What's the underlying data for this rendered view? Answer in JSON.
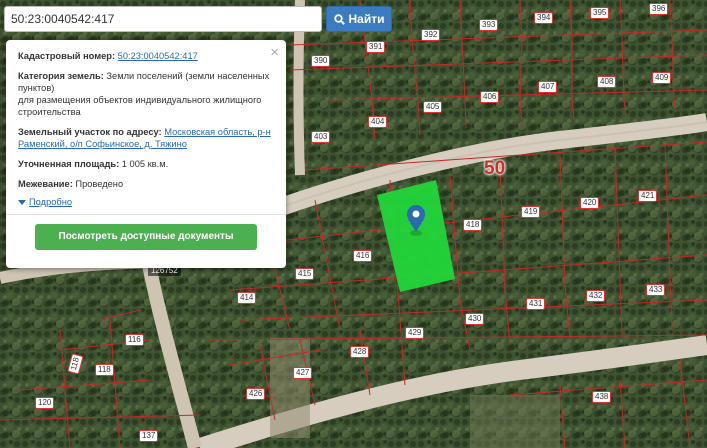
{
  "search": {
    "value": "50:23:0040542:417",
    "button_label": "Найти",
    "button_icon": "search-icon"
  },
  "popup": {
    "close_glyph": "×",
    "cadastral_label": "Кадастровый номер:",
    "cadastral_value": "50:23:0040542:417",
    "category_label": "Категория земель:",
    "category_value": "Земли поселений (земли населенных пунктов)",
    "usage_value": "для размещения объектов индивидуального жилищного строительства",
    "address_label": "Земельный участок по адресу:",
    "address_value": "Московская область, р-н Раменский, о/п Софьинское, д. Тяжино",
    "area_label": "Уточненная площадь:",
    "area_value": "1 005 кв.м.",
    "survey_label": "Межевание:",
    "survey_value": "Проведено",
    "details_label": "Подробно",
    "docs_button": "Посмотреть доступные документы"
  },
  "map": {
    "quarter_label": "50",
    "road_tag": "126752",
    "plots": [
      {
        "label": "393"
      },
      {
        "label": "394"
      },
      {
        "label": "395"
      },
      {
        "label": "396"
      },
      {
        "label": "391"
      },
      {
        "label": "392"
      },
      {
        "label": "390"
      },
      {
        "label": "407"
      },
      {
        "label": "408"
      },
      {
        "label": "409"
      },
      {
        "label": "406"
      },
      {
        "label": "405"
      },
      {
        "label": "404"
      },
      {
        "label": "403"
      },
      {
        "label": "419"
      },
      {
        "label": "420"
      },
      {
        "label": "421"
      },
      {
        "label": "418"
      },
      {
        "label": "416"
      },
      {
        "label": "415"
      },
      {
        "label": "414"
      },
      {
        "label": "431"
      },
      {
        "label": "432"
      },
      {
        "label": "433"
      },
      {
        "label": "430"
      },
      {
        "label": "429"
      },
      {
        "label": "428"
      },
      {
        "label": "427"
      },
      {
        "label": "426"
      },
      {
        "label": "116"
      },
      {
        "label": "118"
      },
      {
        "label": "118"
      },
      {
        "label": "120"
      },
      {
        "label": "137"
      },
      {
        "label": "438"
      }
    ],
    "colors": {
      "selected_plot": "#22d63a",
      "boundary": "#c62828",
      "pin": "#2a6ab0",
      "road": "#d6cdbf"
    }
  }
}
